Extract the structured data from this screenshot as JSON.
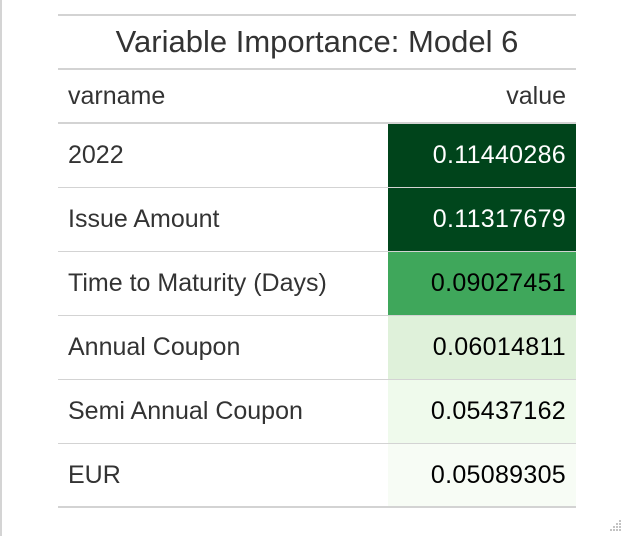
{
  "table": {
    "title": "Variable Importance: Model 6",
    "columns": [
      "varname",
      "value"
    ],
    "rows": [
      {
        "varname": "2022",
        "value": "0.11440286",
        "fill": "#00441b",
        "text_color": "#ffffff"
      },
      {
        "varname": "Issue Amount",
        "value": "0.11317679",
        "fill": "#00461c",
        "text_color": "#ffffff"
      },
      {
        "varname": "Time to Maturity (Days)",
        "value": "0.09027451",
        "fill": "#3fa75b",
        "text_color": "#000000"
      },
      {
        "varname": "Annual Coupon",
        "value": "0.06014811",
        "fill": "#dff1da",
        "text_color": "#000000"
      },
      {
        "varname": "Semi Annual Coupon",
        "value": "0.05437162",
        "fill": "#effaec",
        "text_color": "#000000"
      },
      {
        "varname": "EUR",
        "value": "0.05089305",
        "fill": "#f7fcf5",
        "text_color": "#000000"
      }
    ]
  }
}
